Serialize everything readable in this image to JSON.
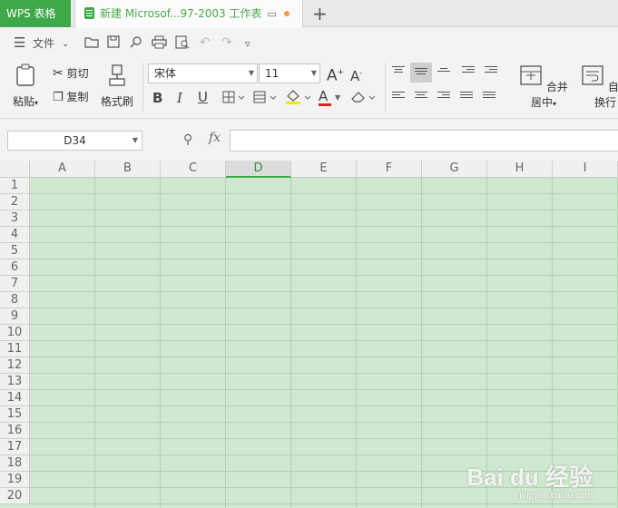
{
  "titlebar": {
    "app_tab": "WPS 表格",
    "doc_tab": "新建 Microsof...97-2003 工作表",
    "new_tab": "+"
  },
  "quickbar": {
    "file_label": "文件"
  },
  "ribbon": {
    "paste": "粘贴",
    "cut": "剪切",
    "copy": "复制",
    "format_painter": "格式刷",
    "font_name": "宋体",
    "font_size": "11",
    "grow_font": "A",
    "shrink_font": "A",
    "bold": "B",
    "italic": "I",
    "underline": "U",
    "font_color_letter": "A",
    "merge_center": "合并居中",
    "wrap_text": "自动换行"
  },
  "formula": {
    "name_box": "D34",
    "fx": "fx",
    "value": ""
  },
  "grid": {
    "columns": [
      "A",
      "B",
      "C",
      "D",
      "E",
      "F",
      "G",
      "H",
      "I"
    ],
    "selected_column": "D",
    "rows": [
      "1",
      "2",
      "3",
      "4",
      "5",
      "6",
      "7",
      "8",
      "9",
      "10",
      "11",
      "12",
      "13",
      "14",
      "15",
      "16",
      "17",
      "18",
      "19",
      "20"
    ],
    "cell_bg": "#cfe8cf"
  },
  "watermark": {
    "brand": "Bai du 经验",
    "url": "jingyan.baidu.com"
  },
  "colors": {
    "accent": "#3fa84a",
    "doc_tab_text": "#4ca84d",
    "unsaved_dot": "#f59a48"
  }
}
